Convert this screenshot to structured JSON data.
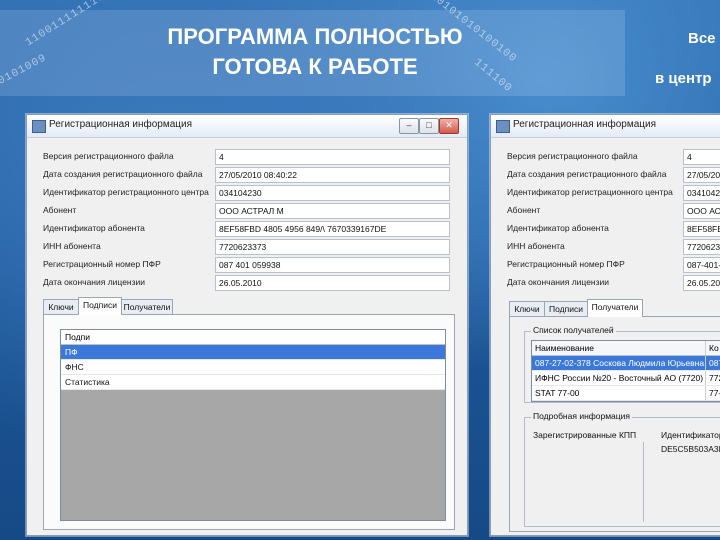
{
  "slide": {
    "title_line1": "ПРОГРАММА ПОЛНОСТЬЮ",
    "title_line2": "ГОТОВА К РАБОТЕ",
    "side_text_line1": "Все",
    "side_text_line2": "в центр",
    "digits_line1": "110011111110",
    "digits_line2": "0101009",
    "digits_line3": "10101010100100",
    "digits_line4": "111100"
  },
  "window_left": {
    "title": "Регистрационная информация",
    "fields": [
      {
        "label": "Версия регистрационного файла",
        "value": "4"
      },
      {
        "label": "Дата создания регистрационного файла",
        "value": "27/05/2010 08:40:22"
      },
      {
        "label": "Идентификатор регистрационного центра",
        "value": "034104230"
      },
      {
        "label": "Абонент",
        "value": "ООО АСТРАЛ М"
      },
      {
        "label": "Идентификатор абонента",
        "value": "8EF58FBD 4805 4956 849/\\ 7670339167DE"
      },
      {
        "label": "ИНН абонента",
        "value": "7720623373"
      },
      {
        "label": "Регистрационный номер ПФР",
        "value": "087 401 059938"
      },
      {
        "label": "Дата окончания лицензии",
        "value": "26.05.2010"
      }
    ],
    "tabs": [
      "Ключи",
      "Подписи",
      "Получатели"
    ],
    "list": {
      "header": "Подпи",
      "rows": [
        "ПФ",
        "ФНС",
        "Статистика"
      ]
    }
  },
  "window_right": {
    "title": "Регистрационная информация",
    "fields": [
      {
        "label": "Версия регистрационного файла",
        "value": "4"
      },
      {
        "label": "Дата создания регистрационного файла",
        "value": "27/05/20"
      },
      {
        "label": "Идентификатор регистрационного центра",
        "value": "03410423"
      },
      {
        "label": "Абонент",
        "value": "ООО АСТ"
      },
      {
        "label": "Идентификатор абонента",
        "value": "8EF58FBD"
      },
      {
        "label": "ИНН абонента",
        "value": "77206233"
      },
      {
        "label": "Регистрационный номер ПФР",
        "value": "087-401-0"
      },
      {
        "label": "Дата окончания лицензии",
        "value": "26.05.201"
      }
    ],
    "tabs": [
      "Ключи",
      "Подписи",
      "Получатели"
    ],
    "recipients_group": "Список получателей",
    "grid": {
      "col_name": "Наименование",
      "col_code": "Ко",
      "rows": [
        {
          "name": "087-27-02-378 Соскова Людмила Юрьевна",
          "code": "087"
        },
        {
          "name": "ИФНС России №20 - Восточный АО (7720)",
          "code": "772"
        },
        {
          "name": "STAT 77-00",
          "code": "77-"
        }
      ]
    },
    "extra_group": "Подробная информация",
    "kpp_label": "Зарегистрированные КПП",
    "ident_label": "Идентификатор",
    "ident_value": "DE5C5B503A3F"
  }
}
